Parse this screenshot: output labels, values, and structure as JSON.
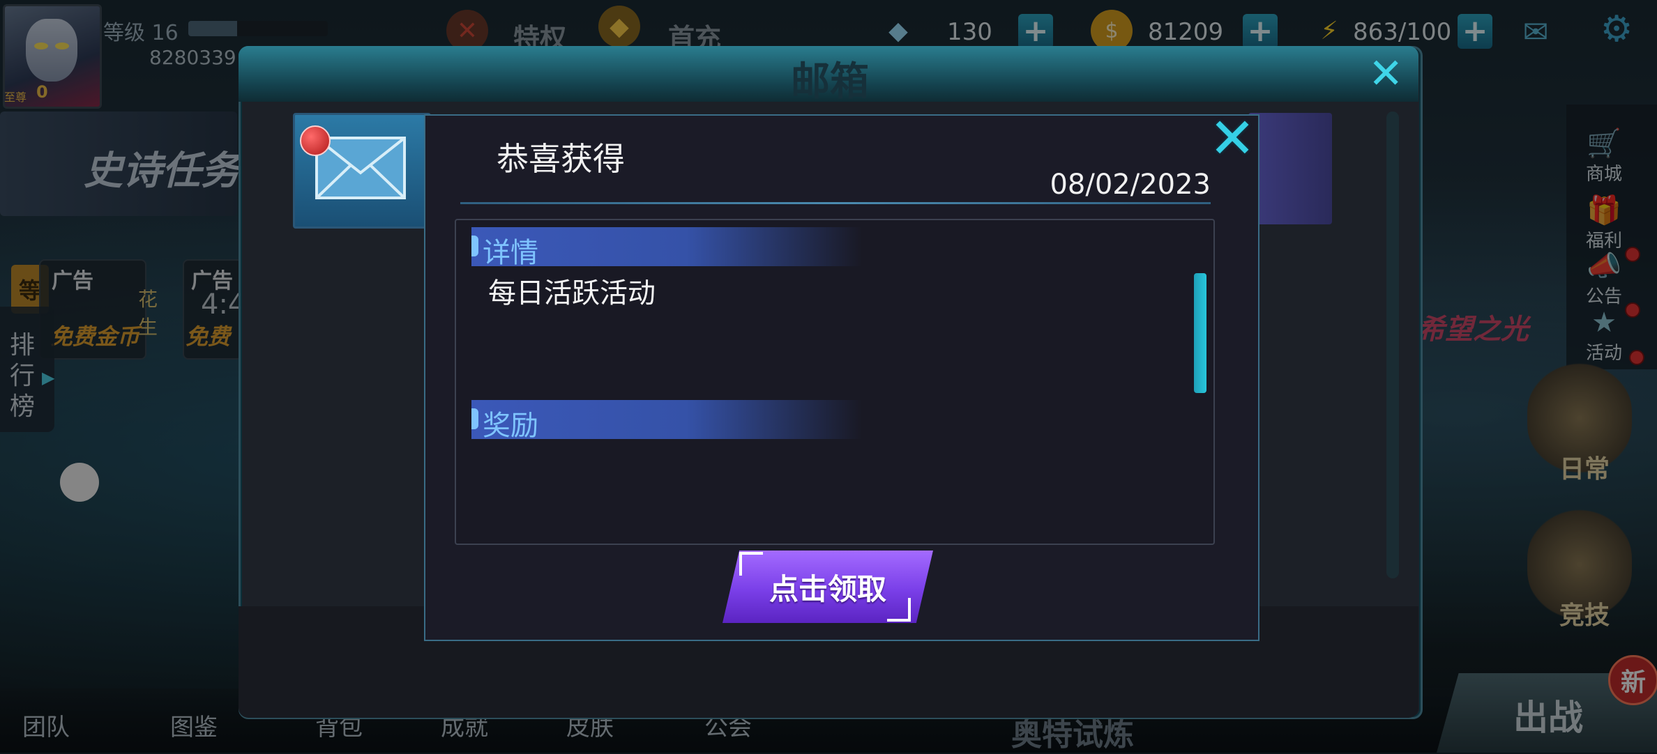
{
  "player": {
    "level_label": "等级",
    "level": "16",
    "level_progress": 0.35,
    "id": "8280339",
    "rank_tag": "至尊",
    "rank_value": "0"
  },
  "resources": {
    "diamond": "130",
    "gold": "81209",
    "energy": "863/100"
  },
  "top_menu": {
    "privilege": "特权",
    "first_recharge": "首充"
  },
  "left": {
    "epic_task": "史诗任务",
    "ads": [
      {
        "label": "广告",
        "sub": "免费金币",
        "extra": "花生"
      },
      {
        "label": "广告",
        "time": "4:4",
        "sub": "免费"
      }
    ],
    "rank_board": "排行榜",
    "level_tab": "等"
  },
  "right": {
    "items": [
      {
        "label": "商城",
        "icon": "cart-icon",
        "dot": false
      },
      {
        "label": "福利",
        "icon": "gift-icon",
        "dot": false
      },
      {
        "label": "公告",
        "icon": "megaphone-icon",
        "dot": true
      },
      {
        "label": "活动",
        "icon": "star-icon",
        "dot": true
      }
    ],
    "event_banner": "希望之光",
    "daily": "日常",
    "arena": "竞技"
  },
  "bottom": {
    "items": [
      "团队",
      "图鉴",
      "背包",
      "成就",
      "皮肤",
      "公会"
    ],
    "trial": "奥特试炼",
    "battle": "出战",
    "new_badge": "新"
  },
  "mailbox": {
    "title": "邮箱"
  },
  "popup": {
    "title": "恭喜获得",
    "date": "08/02/2023",
    "details_label": "详情",
    "details_text": "每日活跃活动",
    "rewards_label": "奖励",
    "claim_button": "点击领取"
  },
  "colors": {
    "accent": "#35d0e6",
    "section": "#3b58b8",
    "button": "#7a3fe8"
  }
}
